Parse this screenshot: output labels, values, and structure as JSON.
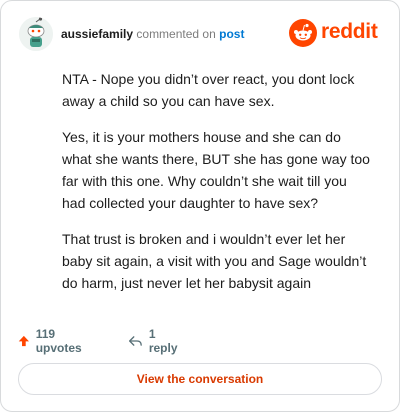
{
  "header": {
    "username": "aussiefamily",
    "commented_on": "commented on",
    "post_link": "post",
    "brand": "reddit"
  },
  "comment": {
    "paragraphs": [
      "NTA - Nope you didn’t over react, you dont lock away a child so you can have sex.",
      "Yes, it is your mothers house and she can do what she wants there, BUT she has gone way too far with this one. Why couldn’t she wait till you had collected your daughter to have sex?",
      "That trust is broken and i wouldn’t ever let her baby sit again, a visit with you and Sage wouldn’t do harm, just never let her babysit again"
    ]
  },
  "footer": {
    "upvotes": "119 upvotes",
    "replies": "1 reply"
  },
  "cta": {
    "label": "View the conversation"
  },
  "colors": {
    "brand": "#ff4500",
    "upvote": "#ff4500",
    "link": "#0079d3",
    "cta_text": "#d93a00",
    "meta_gray": "#576f76"
  },
  "icons": {
    "avatar": "snoo-avatar",
    "brand": "reddit-logo-icon",
    "upvote": "upvote-arrow-icon",
    "reply": "reply-arrow-icon"
  }
}
